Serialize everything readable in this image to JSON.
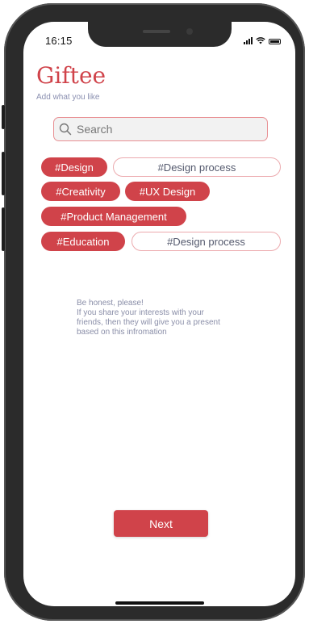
{
  "status_bar": {
    "time": "16:15"
  },
  "header": {
    "title": "Giftee",
    "subtitle": "Add what you like"
  },
  "search": {
    "placeholder": "Search",
    "value": ""
  },
  "tags": {
    "design": "#Design",
    "design_process_1": "#Design process",
    "creativity": "#Creativity",
    "ux_design": "#UX Design",
    "product_management": "#Product Management",
    "education": "#Education",
    "design_process_2": "#Design process"
  },
  "info": {
    "lines": [
      "Be honest, please!",
      "If you share your interests with your",
      "friends, then they will give you a present",
      "based on this infromation"
    ]
  },
  "footer": {
    "next_label": "Next"
  },
  "colors": {
    "accent": "#d0434a",
    "muted_text": "#8a8fb0",
    "frame": "#2b2b2b"
  },
  "icons": [
    "search-icon",
    "signal-icon",
    "wifi-icon",
    "battery-icon"
  ]
}
